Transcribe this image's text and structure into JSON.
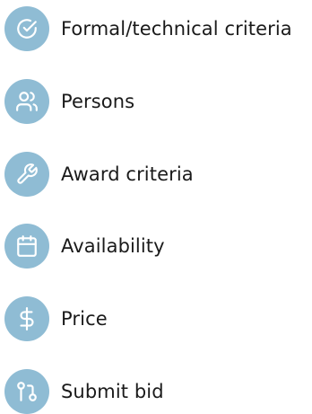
{
  "nav": {
    "items": [
      {
        "label": "Formal/technical criteria",
        "icon": "check-circle-icon"
      },
      {
        "label": "Persons",
        "icon": "users-icon"
      },
      {
        "label": "Award criteria",
        "icon": "wrench-icon"
      },
      {
        "label": "Availability",
        "icon": "calendar-icon"
      },
      {
        "label": "Price",
        "icon": "dollar-icon"
      },
      {
        "label": "Submit bid",
        "icon": "git-pull-request-icon"
      }
    ]
  },
  "colors": {
    "icon_background": "#8fbcd4",
    "icon_foreground": "#ffffff",
    "label_text": "#1a1a1a"
  }
}
